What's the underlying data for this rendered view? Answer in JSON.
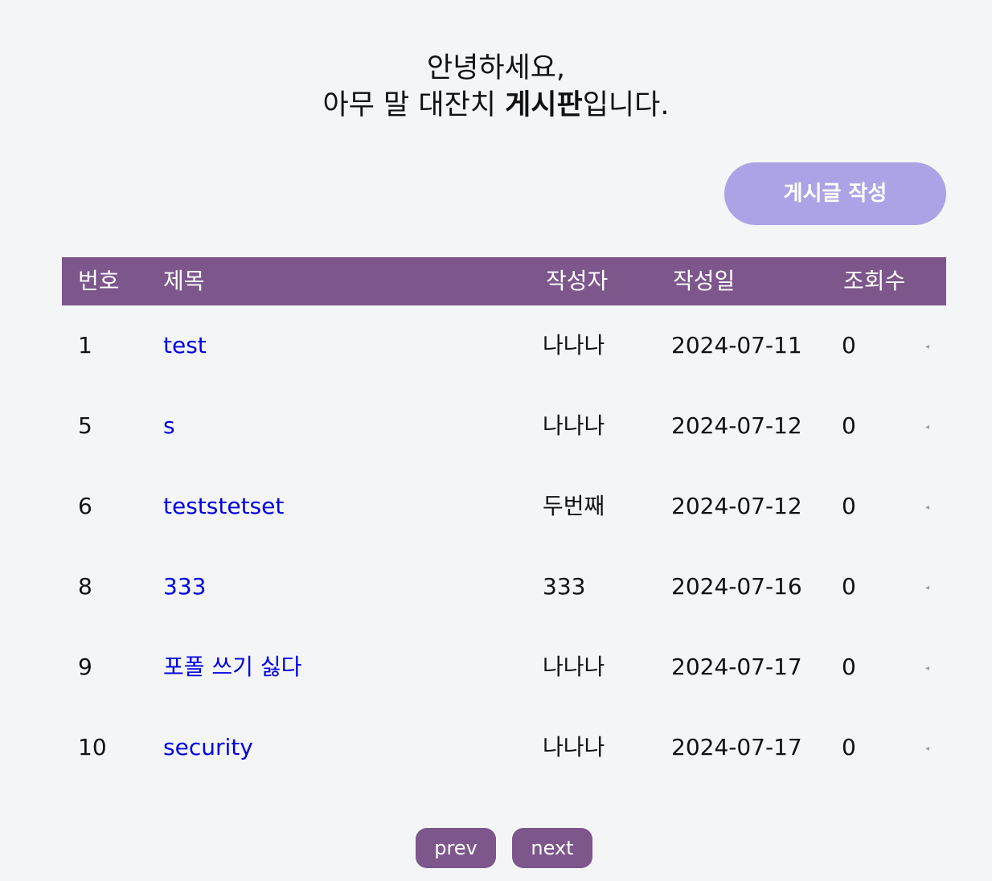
{
  "greeting": {
    "line1": "안녕하세요,",
    "line2_prefix": "아무 말 대잔치 ",
    "line2_bold": "게시판",
    "line2_suffix": "입니다."
  },
  "write_button_label": "게시글 작성",
  "table": {
    "headers": {
      "no": "번호",
      "title": "제목",
      "author": "작성자",
      "date": "작성일",
      "views": "조회수"
    },
    "rows": [
      {
        "no": "1",
        "title": "test",
        "author": "나나나",
        "date": "2024-07-11",
        "views": "0"
      },
      {
        "no": "5",
        "title": "s",
        "author": "나나나",
        "date": "2024-07-12",
        "views": "0"
      },
      {
        "no": "6",
        "title": "teststetset",
        "author": "두번째",
        "date": "2024-07-12",
        "views": "0"
      },
      {
        "no": "8",
        "title": "333",
        "author": "333",
        "date": "2024-07-16",
        "views": "0"
      },
      {
        "no": "9",
        "title": "포폴 쓰기 싫다",
        "author": "나나나",
        "date": "2024-07-17",
        "views": "0"
      },
      {
        "no": "10",
        "title": "security",
        "author": "나나나",
        "date": "2024-07-17",
        "views": "0"
      }
    ]
  },
  "pagination": {
    "prev_label": "prev",
    "next_label": "next"
  },
  "colors": {
    "background": "#f4f5f7",
    "header_bg": "#7d568c",
    "button_bg": "#aba3e6",
    "link": "#0000e6"
  }
}
